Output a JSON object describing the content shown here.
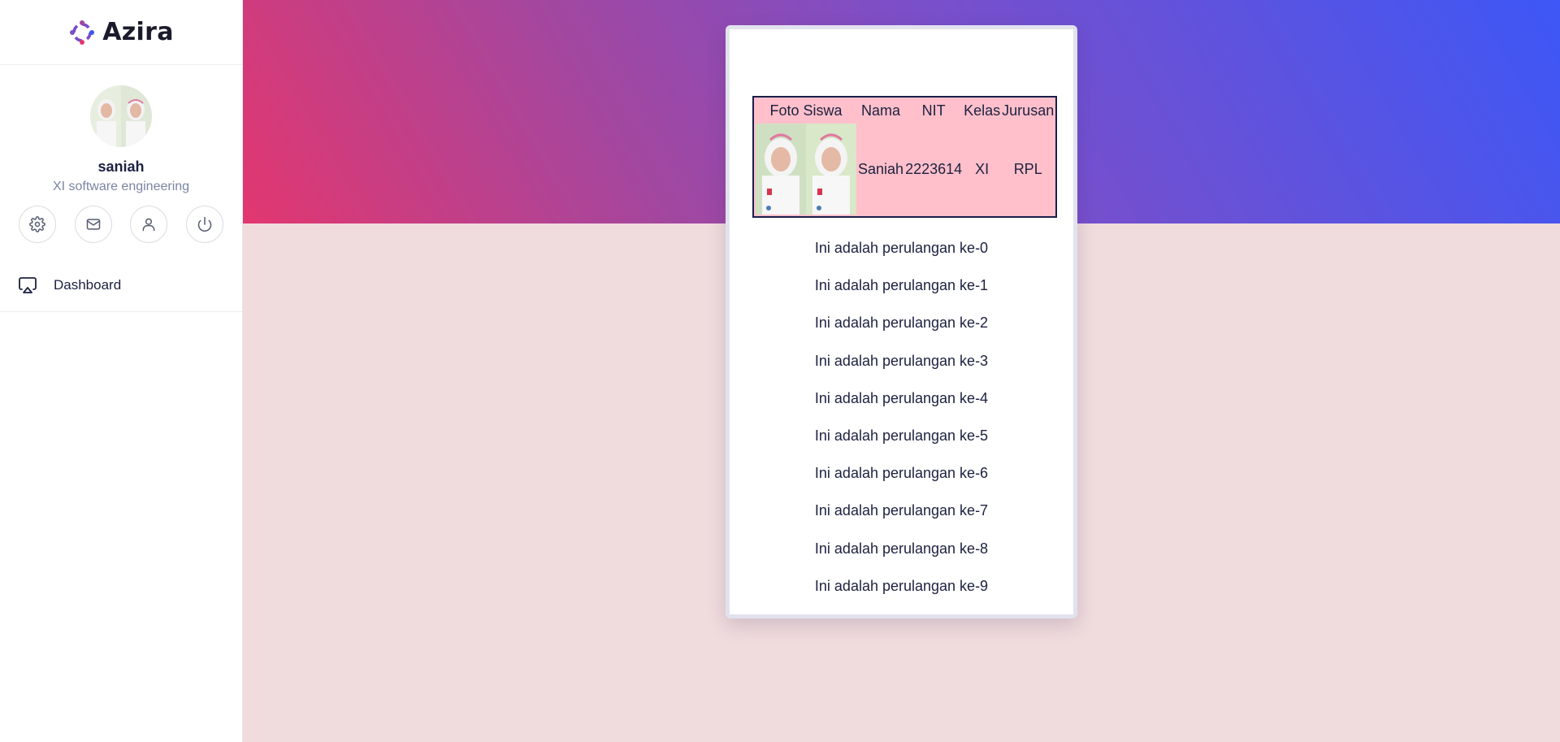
{
  "brand": {
    "name": "Azira"
  },
  "profile": {
    "name": "saniah",
    "role": "XI software engineering",
    "avatar": "student-photo"
  },
  "quick_actions": [
    {
      "icon": "gear-icon"
    },
    {
      "icon": "mail-icon"
    },
    {
      "icon": "user-icon"
    },
    {
      "icon": "power-icon"
    }
  ],
  "nav": [
    {
      "label": "Dashboard",
      "icon": "monitor-icon"
    }
  ],
  "colors": {
    "hero_start": "#e2376f",
    "hero_end": "#3d57f6",
    "page_bg": "#f0dcdd",
    "table_bg": "#ffc0cb",
    "text": "#1c2140"
  },
  "student_table": {
    "headers": [
      "Foto Siswa",
      "Nama",
      "NIT",
      "Kelas",
      "Jurusan"
    ],
    "row": {
      "nama": "Saniah",
      "nit": "2223614",
      "kelas": "XI",
      "jurusan": "RPL"
    }
  },
  "loop_items": [
    "Ini adalah perulangan ke-0",
    "Ini adalah perulangan ke-1",
    "Ini adalah perulangan ke-2",
    "Ini adalah perulangan ke-3",
    "Ini adalah perulangan ke-4",
    "Ini adalah perulangan ke-5",
    "Ini adalah perulangan ke-6",
    "Ini adalah perulangan ke-7",
    "Ini adalah perulangan ke-8",
    "Ini adalah perulangan ke-9"
  ]
}
